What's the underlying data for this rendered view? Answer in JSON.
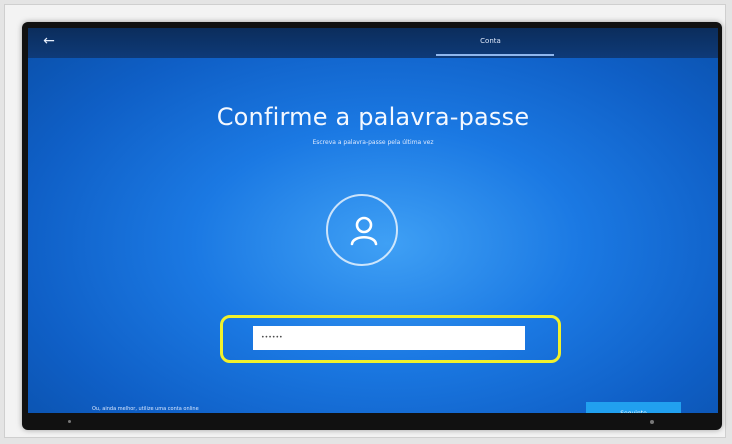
{
  "header": {
    "back_icon": "back-arrow-icon",
    "tab_label": "Conta"
  },
  "main": {
    "title": "Confirme a palavra-passe",
    "subtitle": "Escreva a palavra-passe pela última vez",
    "avatar_icon": "user-icon",
    "password_value": "••••••"
  },
  "footer": {
    "alt_link": "Ou, ainda melhor, utilize uma conta online",
    "next_button": "Seguinte"
  },
  "colors": {
    "screen_blue": "#1b79e3",
    "highlight_yellow": "#f1f12c",
    "button_blue": "#21a0ef"
  }
}
